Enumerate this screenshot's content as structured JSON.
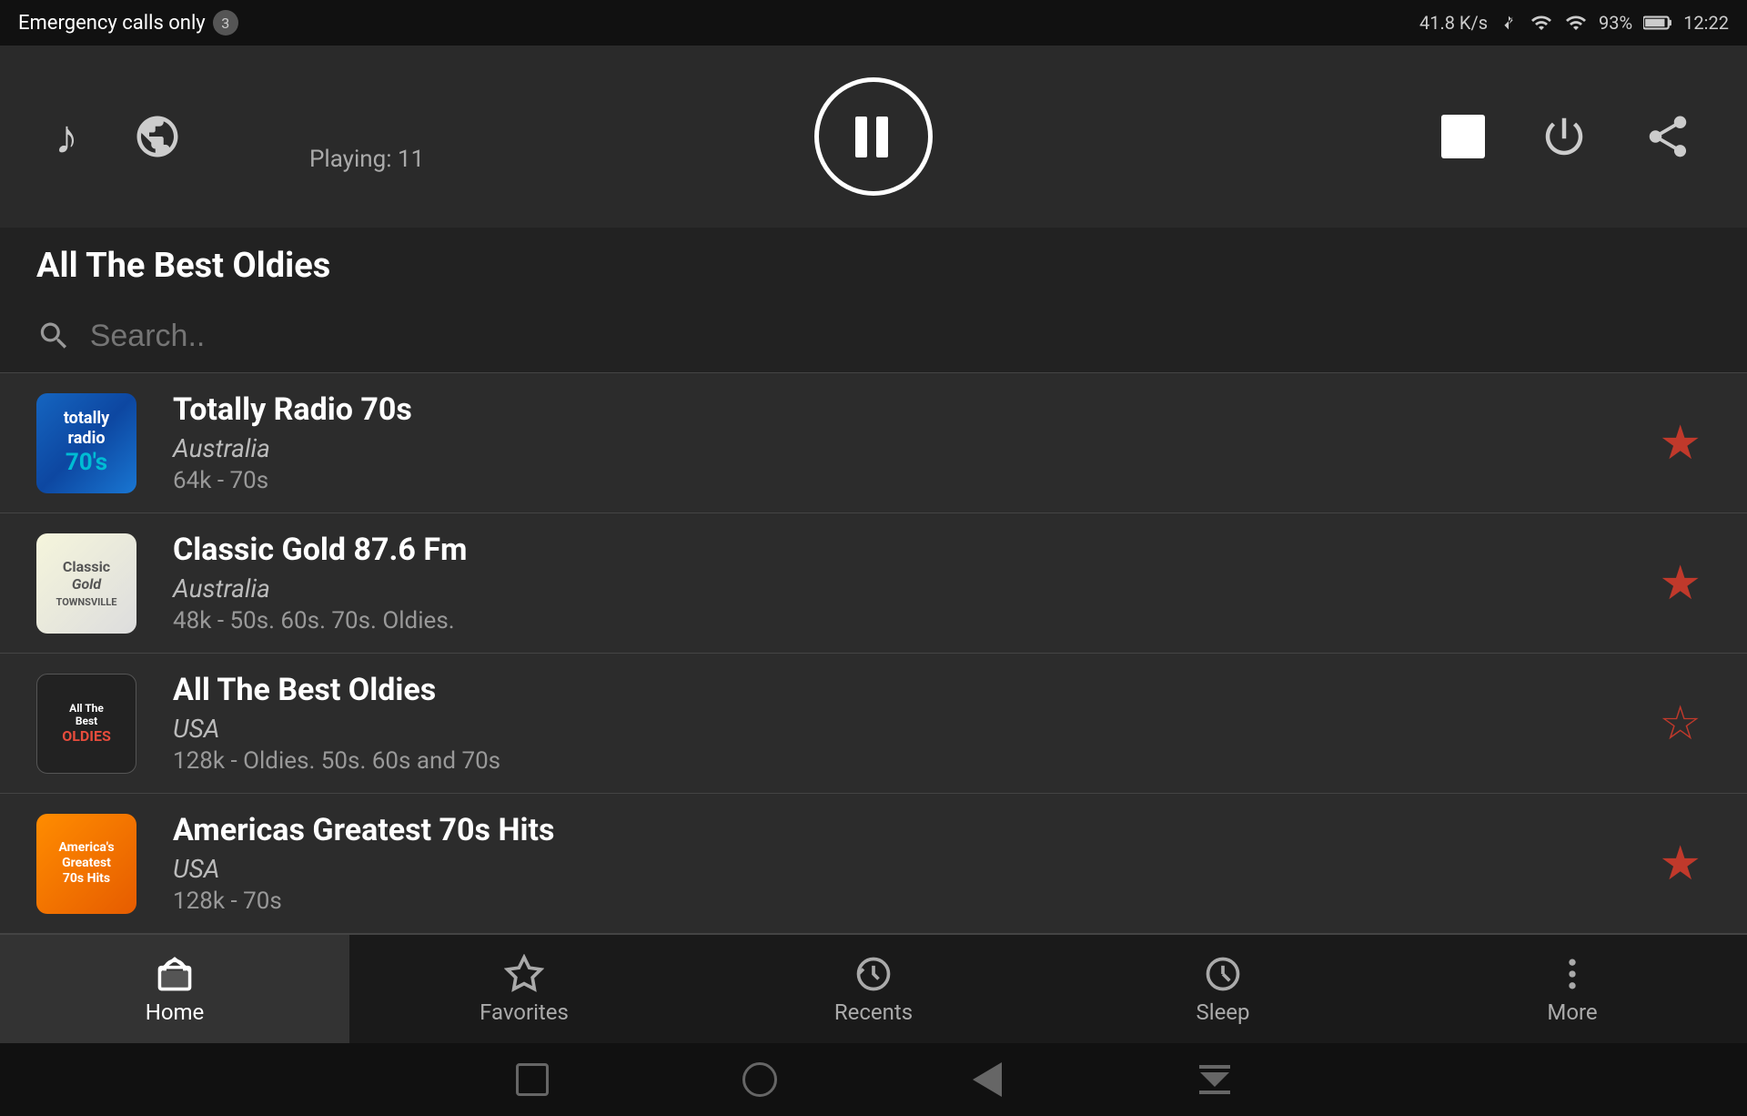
{
  "status_bar": {
    "emergency_text": "Emergency calls only",
    "badge_count": "3",
    "speed": "41.8 K/s",
    "battery": "93%",
    "time": "12:22"
  },
  "player": {
    "playing_label": "Playing: 11",
    "current_station": "All The Best Oldies"
  },
  "search": {
    "placeholder": "Search.."
  },
  "stations": [
    {
      "name": "Totally Radio 70s",
      "country": "Australia",
      "details": "64k - 70s",
      "favorited": true,
      "logo_text": "totally\nradio\n70's"
    },
    {
      "name": "Classic Gold 87.6 Fm",
      "country": "Australia",
      "details": "48k - 50s. 60s. 70s. Oldies.",
      "favorited": true,
      "logo_text": "Classic\nGold\nTOWNSVILLE"
    },
    {
      "name": "All The Best Oldies",
      "country": "USA",
      "details": "128k - Oldies. 50s. 60s and 70s",
      "favorited": false,
      "logo_text": "All The\nBest\nOLDIES"
    },
    {
      "name": "Americas Greatest 70s Hits",
      "country": "USA",
      "details": "128k - 70s",
      "favorited": true,
      "logo_text": "America's\nGreatest\n70s Hits"
    }
  ],
  "bottom_nav": {
    "items": [
      {
        "label": "Home",
        "icon": "home",
        "active": true
      },
      {
        "label": "Favorites",
        "icon": "star",
        "active": false
      },
      {
        "label": "Recents",
        "icon": "history",
        "active": false
      },
      {
        "label": "Sleep",
        "icon": "sleep",
        "active": false
      },
      {
        "label": "More",
        "icon": "more",
        "active": false
      }
    ]
  }
}
